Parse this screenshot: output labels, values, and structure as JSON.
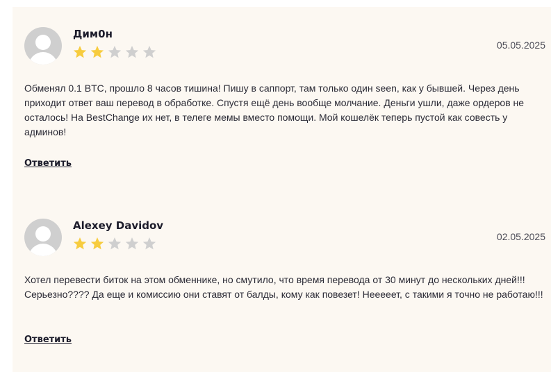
{
  "reviews": [
    {
      "author": "Дим0н",
      "rating": 2,
      "max_rating": 5,
      "date": "05.05.2025",
      "text": "Обменял 0.1 BTC, прошло 8 часов тишина! Пишу в саппорт, там только один seen, как у бывшей. Через день приходит ответ ваш перевод в обработке. Спустя ещё день вообще молчание. Деньги ушли, даже ордеров не осталось! На BestChange их нет, в телеге мемы вместо помощи. Мой кошелёк теперь пустой как совесть у админов!",
      "reply_label": "Ответить"
    },
    {
      "author": "Alexey Davidov",
      "rating": 2,
      "max_rating": 5,
      "date": "02.05.2025",
      "text": "Хотел перевести биток на этом обменнике, но смутило, что время перевода от 30 минут до нескольких дней!!! Серьезно???? Да еще и комиссию они ставят от балды, кому как повезет! Нееееет, с такими я точно не работаю!!!",
      "reply_label": "Ответить"
    }
  ],
  "colors": {
    "star_filled": "#f7cc3e",
    "star_empty": "#cfcfcf",
    "background": "#fcf8f2"
  },
  "icons": {
    "avatar": "user-placeholder-icon",
    "star": "star-icon"
  }
}
